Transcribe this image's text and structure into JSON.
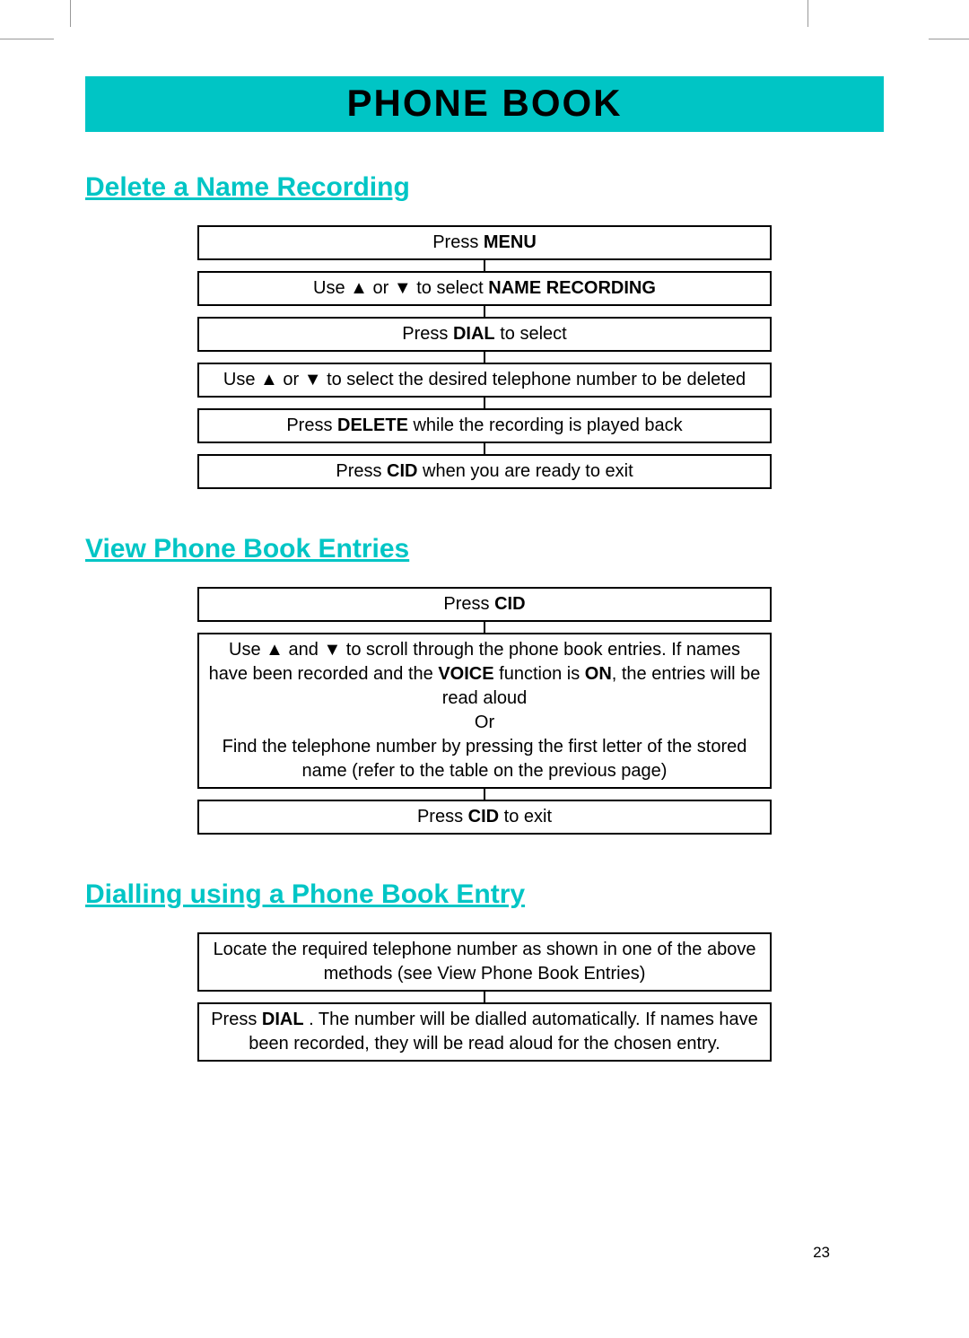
{
  "banner": "PHONE BOOK",
  "section1": {
    "title": "Delete a Name Recording",
    "steps": [
      "Press <b>MENU</b>",
      "Use ▲ or ▼ to select <b>NAME RECORDING</b>",
      "Press <b>DIAL</b>  to select",
      "Use ▲ or ▼ to select the desired telephone number to be deleted",
      "Press <b>DELETE</b> while the recording is played back",
      "Press <b>CID</b> when you are ready to exit"
    ]
  },
  "section2": {
    "title": "View Phone Book Entries",
    "steps": [
      "Press <b>CID</b>",
      "Use ▲ and ▼ to scroll through the phone book entries.  If names have been recorded and the <b>VOICE</b> function is <b>ON</b>, the entries will be read aloud<br>Or<br>Find the telephone number by pressing the first letter of the stored name (refer to the table on the previous page)",
      "Press <b>CID</b> to exit"
    ]
  },
  "section3": {
    "title": "Dialling using a Phone Book Entry",
    "steps": [
      "Locate the required telephone number as shown in one of the above methods (see View Phone Book Entries)",
      "Press <b>DIAL</b> . The number will be dialled automatically.  If names have been recorded, they will be read aloud for the chosen entry."
    ]
  },
  "page_number": "23"
}
